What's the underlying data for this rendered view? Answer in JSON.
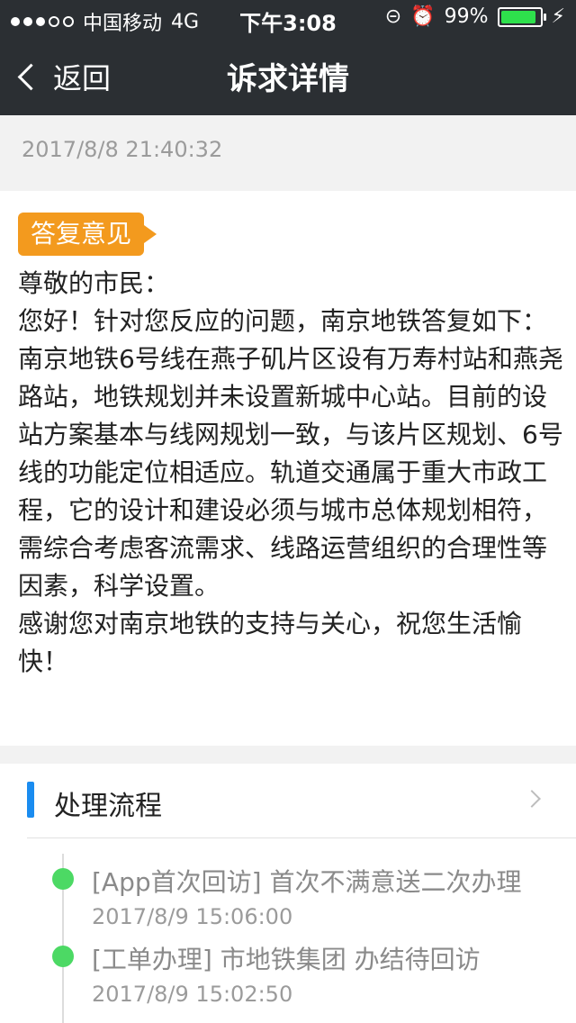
{
  "status_bar": {
    "carrier": "中国移动",
    "network": "4G",
    "time": "下午3:08",
    "battery_percent": "99%",
    "signal_filled": 3,
    "signal_total": 5,
    "icons": [
      "orientation-lock-icon",
      "alarm-icon",
      "charging-icon"
    ]
  },
  "nav": {
    "back_label": "返回",
    "title": "诉求详情"
  },
  "request": {
    "datetime": "2017/8/8 21:40:32"
  },
  "reply": {
    "badge": "答复意见",
    "text": "尊敬的市民：\n您好！针对您反应的问题，南京地铁答复如下：\n南京地铁6号线在燕子矶片区设有万寿村站和燕尧路站，地铁规划并未设置新城中心站。目前的设站方案基本与线网规划一致，与该片区规划、6号线的功能定位相适应。轨道交通属于重大市政工程，它的设计和建设必须与城市总体规划相符，需综合考虑客流需求、线路运营组织的合理性等因素，科学设置。\n感谢您对南京地铁的支持与关心，祝您生活愉快！"
  },
  "process": {
    "title": "处理流程",
    "steps": [
      {
        "title": "[App首次回访] 首次不满意送二次办理",
        "time": "2017/8/9 15:06:00"
      },
      {
        "title": "[工单办理] 市地铁集团 办结待回访",
        "time": "2017/8/9 15:02:50"
      }
    ]
  },
  "colors": {
    "header_bg": "#2b2f33",
    "badge_orange": "#f39a1e",
    "accent_blue": "#1a8cf0",
    "timeline_green": "#4cd964",
    "battery_green": "#2ee04c"
  }
}
